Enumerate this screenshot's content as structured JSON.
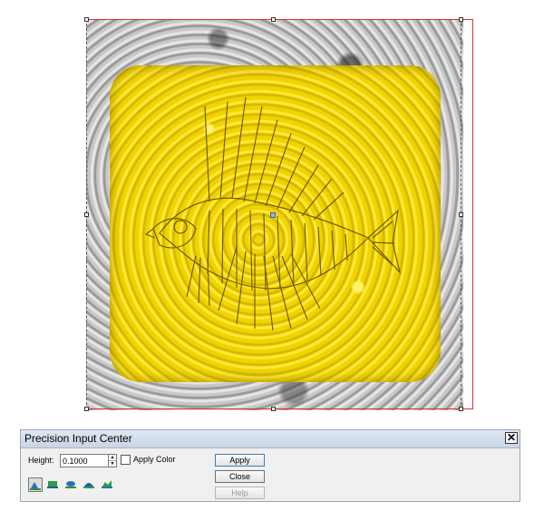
{
  "dialog": {
    "title": "Precision Input Center",
    "close_glyph": "✕",
    "height_label": "Height:",
    "height_value": "0.1000",
    "apply_color_label": "Apply Color",
    "apply_color_checked": false,
    "buttons": {
      "apply": "Apply",
      "close": "Close",
      "help": "Help"
    },
    "tools": [
      {
        "name": "relief-tool-1-icon",
        "active": true
      },
      {
        "name": "relief-tool-2-icon",
        "active": false
      },
      {
        "name": "relief-tool-3-icon",
        "active": false
      },
      {
        "name": "relief-tool-4-icon",
        "active": false
      },
      {
        "name": "relief-tool-5-icon",
        "active": false
      }
    ]
  },
  "canvas": {
    "artwork": "fish-relief",
    "colors": {
      "relief": "#f2d60a",
      "background_texture": "#b5b5b5",
      "bounds": "#e03030",
      "selection": "#555555"
    }
  }
}
